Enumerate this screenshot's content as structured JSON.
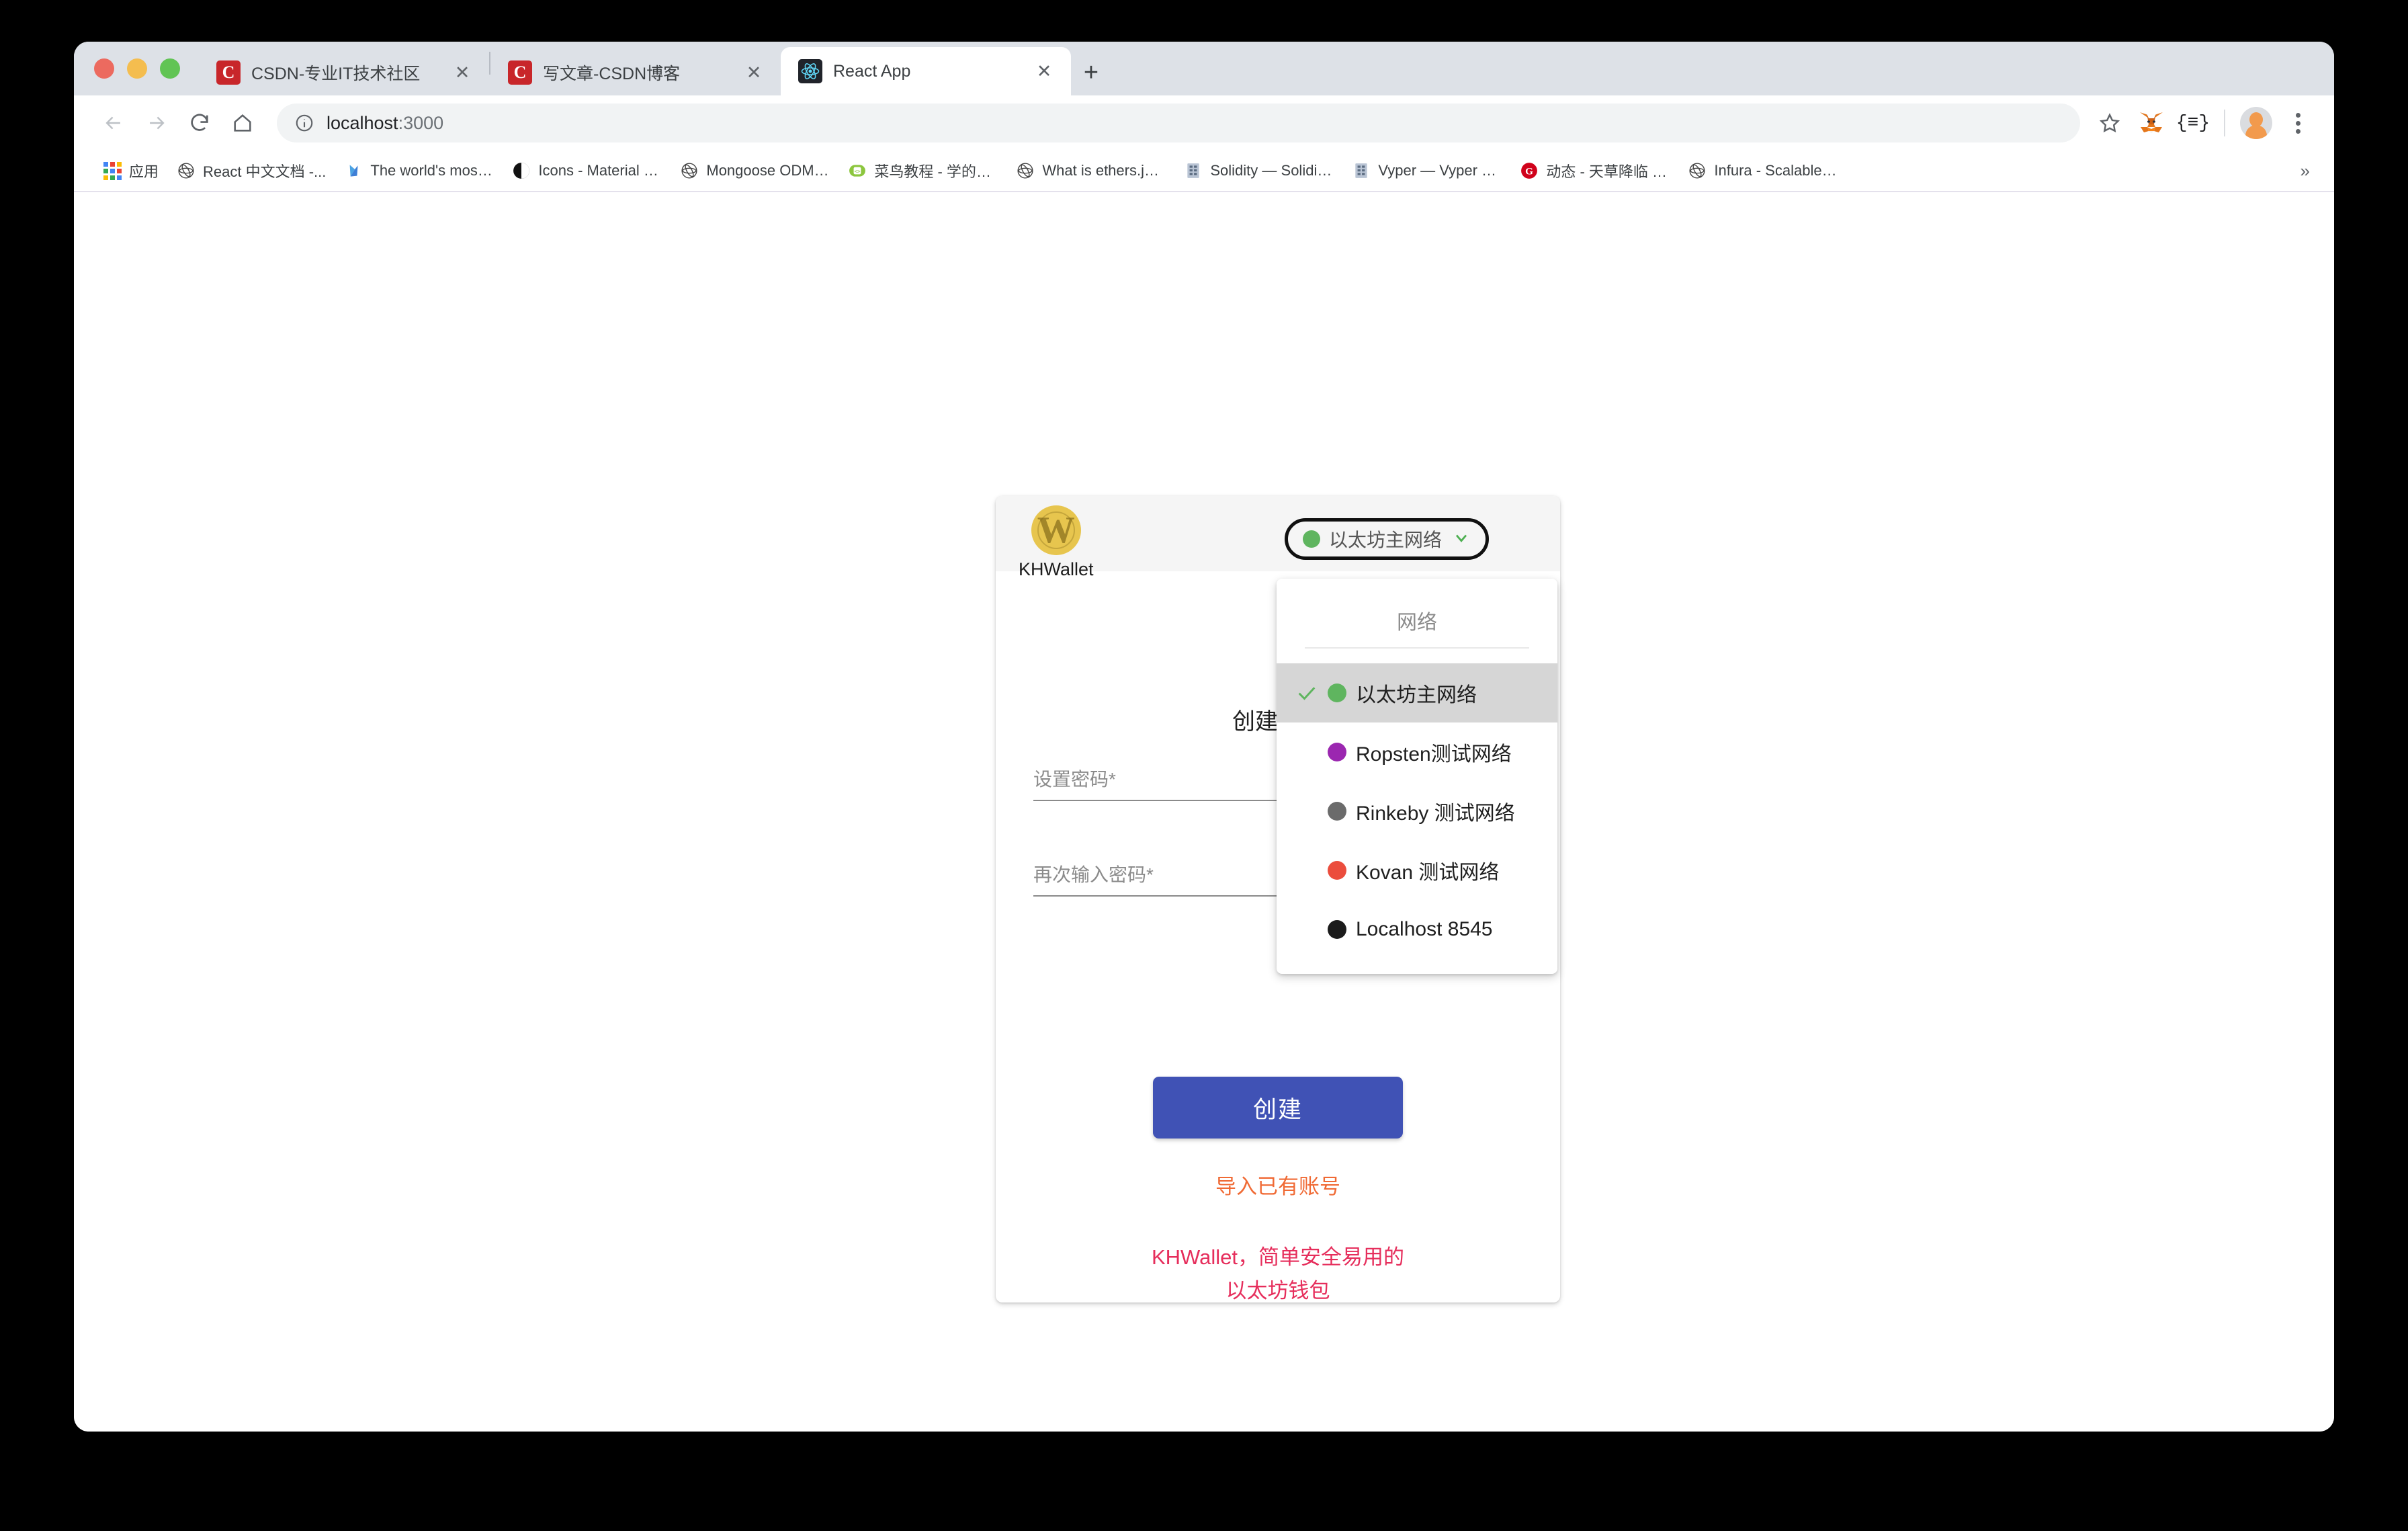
{
  "browser": {
    "tabs": [
      {
        "title": "CSDN-专业IT技术社区",
        "favicon": "csdn-icon",
        "active": false
      },
      {
        "title": "写文章-CSDN博客",
        "favicon": "csdn-icon",
        "active": false
      },
      {
        "title": "React App",
        "favicon": "react-icon",
        "active": true
      }
    ],
    "new_tab_label": "+",
    "close_label": "✕",
    "nav": {
      "back": "←",
      "forward": "→",
      "reload": "⟳",
      "home": "⌂"
    },
    "omnibox": {
      "info_icon": "info-circle-icon",
      "host": "localhost",
      "port": ":3000"
    },
    "toolbar_icons": {
      "bookmark_star": "★",
      "metamask": "metamask-fox-icon",
      "extension": "{≡}",
      "profile": "avatar-icon",
      "menu": "kebab-menu-icon"
    },
    "bookmarks": [
      {
        "label": "应用",
        "icon": "apps-grid-icon"
      },
      {
        "label": "React 中文文档 -...",
        "icon": "react-icon"
      },
      {
        "label": "The world's most p...",
        "icon": "mongodb-icon"
      },
      {
        "label": "Icons - Material De...",
        "icon": "material-icon"
      },
      {
        "label": "Mongoose ODM v5...",
        "icon": "react-icon"
      },
      {
        "label": "菜鸟教程 - 学的不...",
        "icon": "runoob-icon"
      },
      {
        "label": "What is ethers.js —...",
        "icon": "react-icon"
      },
      {
        "label": "Solidity — Solidity...",
        "icon": "solidity-icon"
      },
      {
        "label": "Vyper — Vyper doc...",
        "icon": "vyper-icon"
      },
      {
        "label": "动态 - 天草降临 (Ti...",
        "icon": "github-red-icon"
      },
      {
        "label": "Infura - Scalable Bl...",
        "icon": "react-icon"
      }
    ],
    "bookmarks_overflow": "»"
  },
  "wallet": {
    "brand_name": "KHWallet",
    "brand_logo_glyph": "W",
    "network_pill": {
      "label": "以太坊主网络",
      "dot_color": "#5fb55f",
      "chevron": "⌄"
    },
    "fab": {
      "icon": "person-add-icon",
      "color": "#e0264f"
    },
    "title": "创建一个",
    "fields": [
      {
        "label": "设置密码",
        "required_mark": "*",
        "value": ""
      },
      {
        "label": "再次输入密码",
        "required_mark": "*",
        "value": ""
      }
    ],
    "create_button": "创建",
    "import_link": "导入已有账号",
    "tagline_line1": "KHWallet，简单安全易用的",
    "tagline_line2": "以太坊钱包",
    "colors": {
      "create_button": "#4052b5",
      "import_link": "#f06a34",
      "tagline": "#e62e5c"
    }
  },
  "network_dropdown": {
    "header": "网络",
    "check_glyph": "✓",
    "items": [
      {
        "label": "以太坊主网络",
        "dot": "#5fb55f",
        "selected": true
      },
      {
        "label": "Ropsten测试网络",
        "dot": "#9b27b0",
        "selected": false
      },
      {
        "label": "Rinkeby 测试网络",
        "dot": "#6b6b6b",
        "selected": false
      },
      {
        "label": "Kovan 测试网络",
        "dot": "#eb4d3d",
        "selected": false
      },
      {
        "label": "Localhost 8545",
        "dot": "#1b1b1b",
        "selected": false
      }
    ]
  }
}
